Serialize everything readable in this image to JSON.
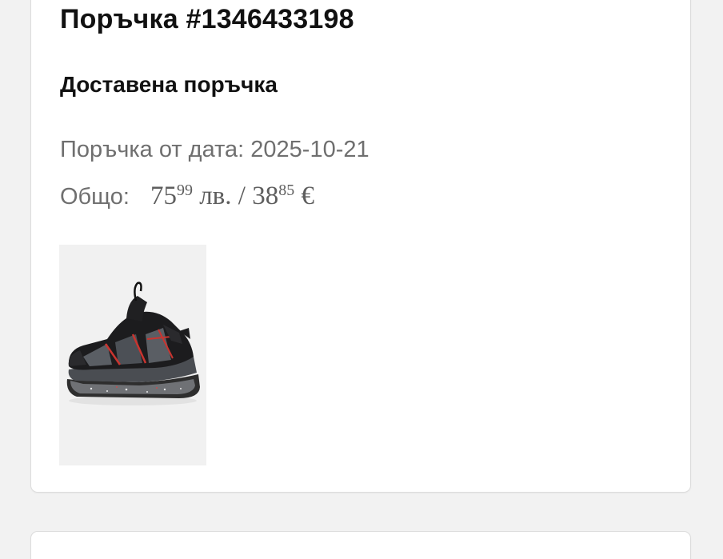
{
  "order": {
    "title": "Поръчка #1346433198",
    "status": "Доставена поръчка",
    "date_text": "Поръчка от дата: 2025-10-21",
    "total_label": "Общо:",
    "price_bgn": {
      "int": "75",
      "dec": "99",
      "currency": "лв."
    },
    "separator": "/",
    "price_eur": {
      "int": "38",
      "dec": "85",
      "currency": "€"
    }
  },
  "product": {
    "image_icon": "black-red-kids-sneaker-image"
  },
  "colors": {
    "background": "#f2f2f2",
    "card": "#ffffff",
    "title_text": "#111111",
    "muted_text": "#6f6f6f"
  }
}
